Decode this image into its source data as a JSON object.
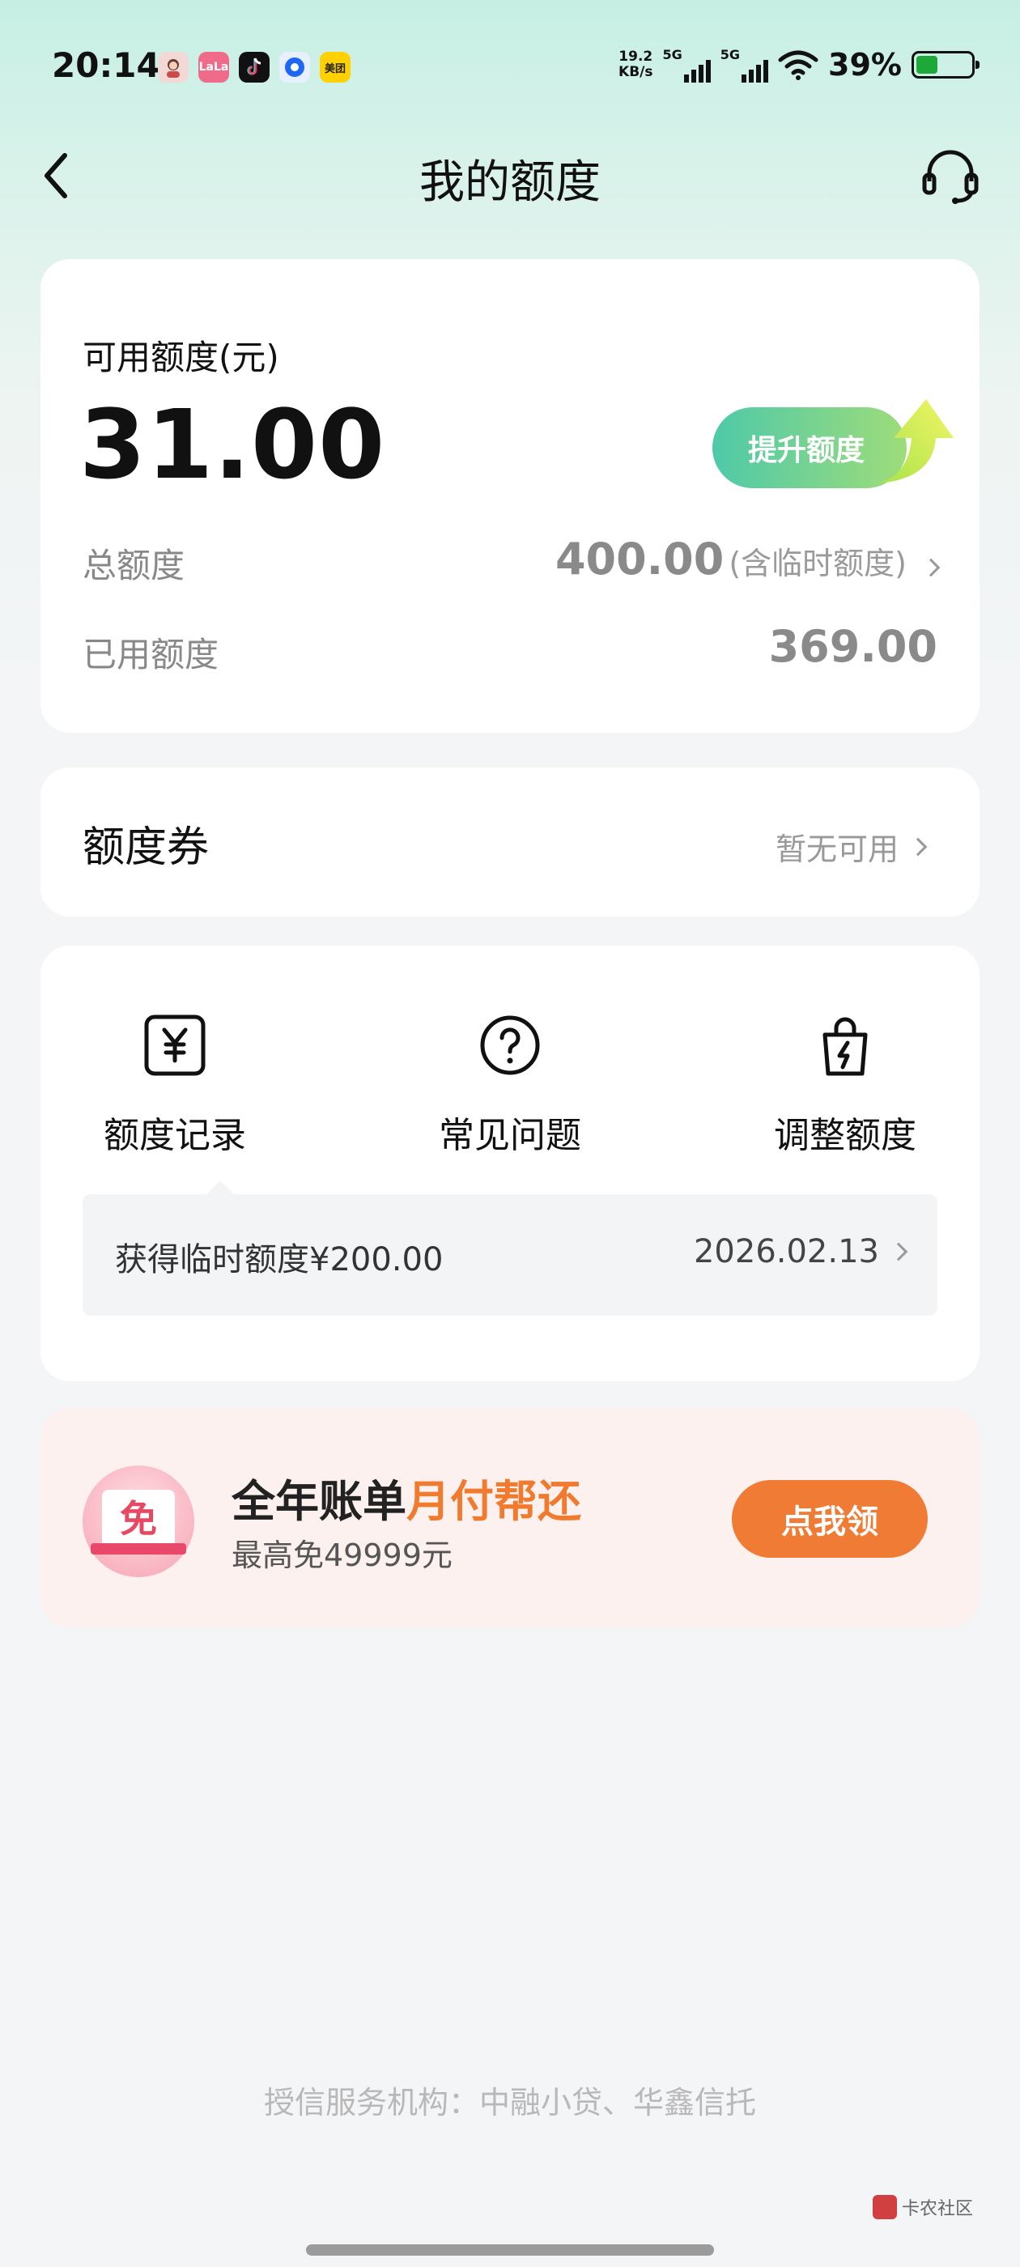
{
  "status_bar": {
    "time": "20:14",
    "net_speed_value": "19.2",
    "net_speed_unit": "KB/s",
    "signal_1": "5G",
    "signal_2": "5G",
    "battery_pct": "39%",
    "battery_level": 0.39,
    "apps": [
      "avatar-app-icon",
      "lala-app-icon",
      "douyin-app-icon",
      "blue-app-icon",
      "meituan-app-icon"
    ],
    "lala_label": "LaLa",
    "meituan_label": "美团"
  },
  "nav": {
    "title": "我的额度"
  },
  "quota": {
    "available_label": "可用额度(元)",
    "available_amount": "31.00",
    "raise_button": "提升额度",
    "total_label": "总额度",
    "total_value": "400.00",
    "total_note": "(含临时额度)",
    "used_label": "已用额度",
    "used_value": "369.00"
  },
  "coupon": {
    "title": "额度券",
    "status": "暂无可用"
  },
  "tools": {
    "items": [
      {
        "label": "额度记录",
        "icon": "yuan-doc-icon"
      },
      {
        "label": "常见问题",
        "icon": "question-circle-icon"
      },
      {
        "label": "调整额度",
        "icon": "lightning-bag-icon"
      }
    ],
    "tip_text": "获得临时额度¥200.00",
    "tip_date": "2026.02.13"
  },
  "promo": {
    "badge_char": "免",
    "title_main": "全年账单",
    "title_highlight": "月付帮还",
    "subtitle": "最高免49999元",
    "button": "点我领"
  },
  "footer": {
    "note": "授信服务机构：中融小贷、华鑫信托",
    "watermark": "卡农社区"
  },
  "colors": {
    "accent_orange": "#f07b34",
    "accent_green": "#4ec9a9",
    "header_mint": "#c6efe4"
  }
}
